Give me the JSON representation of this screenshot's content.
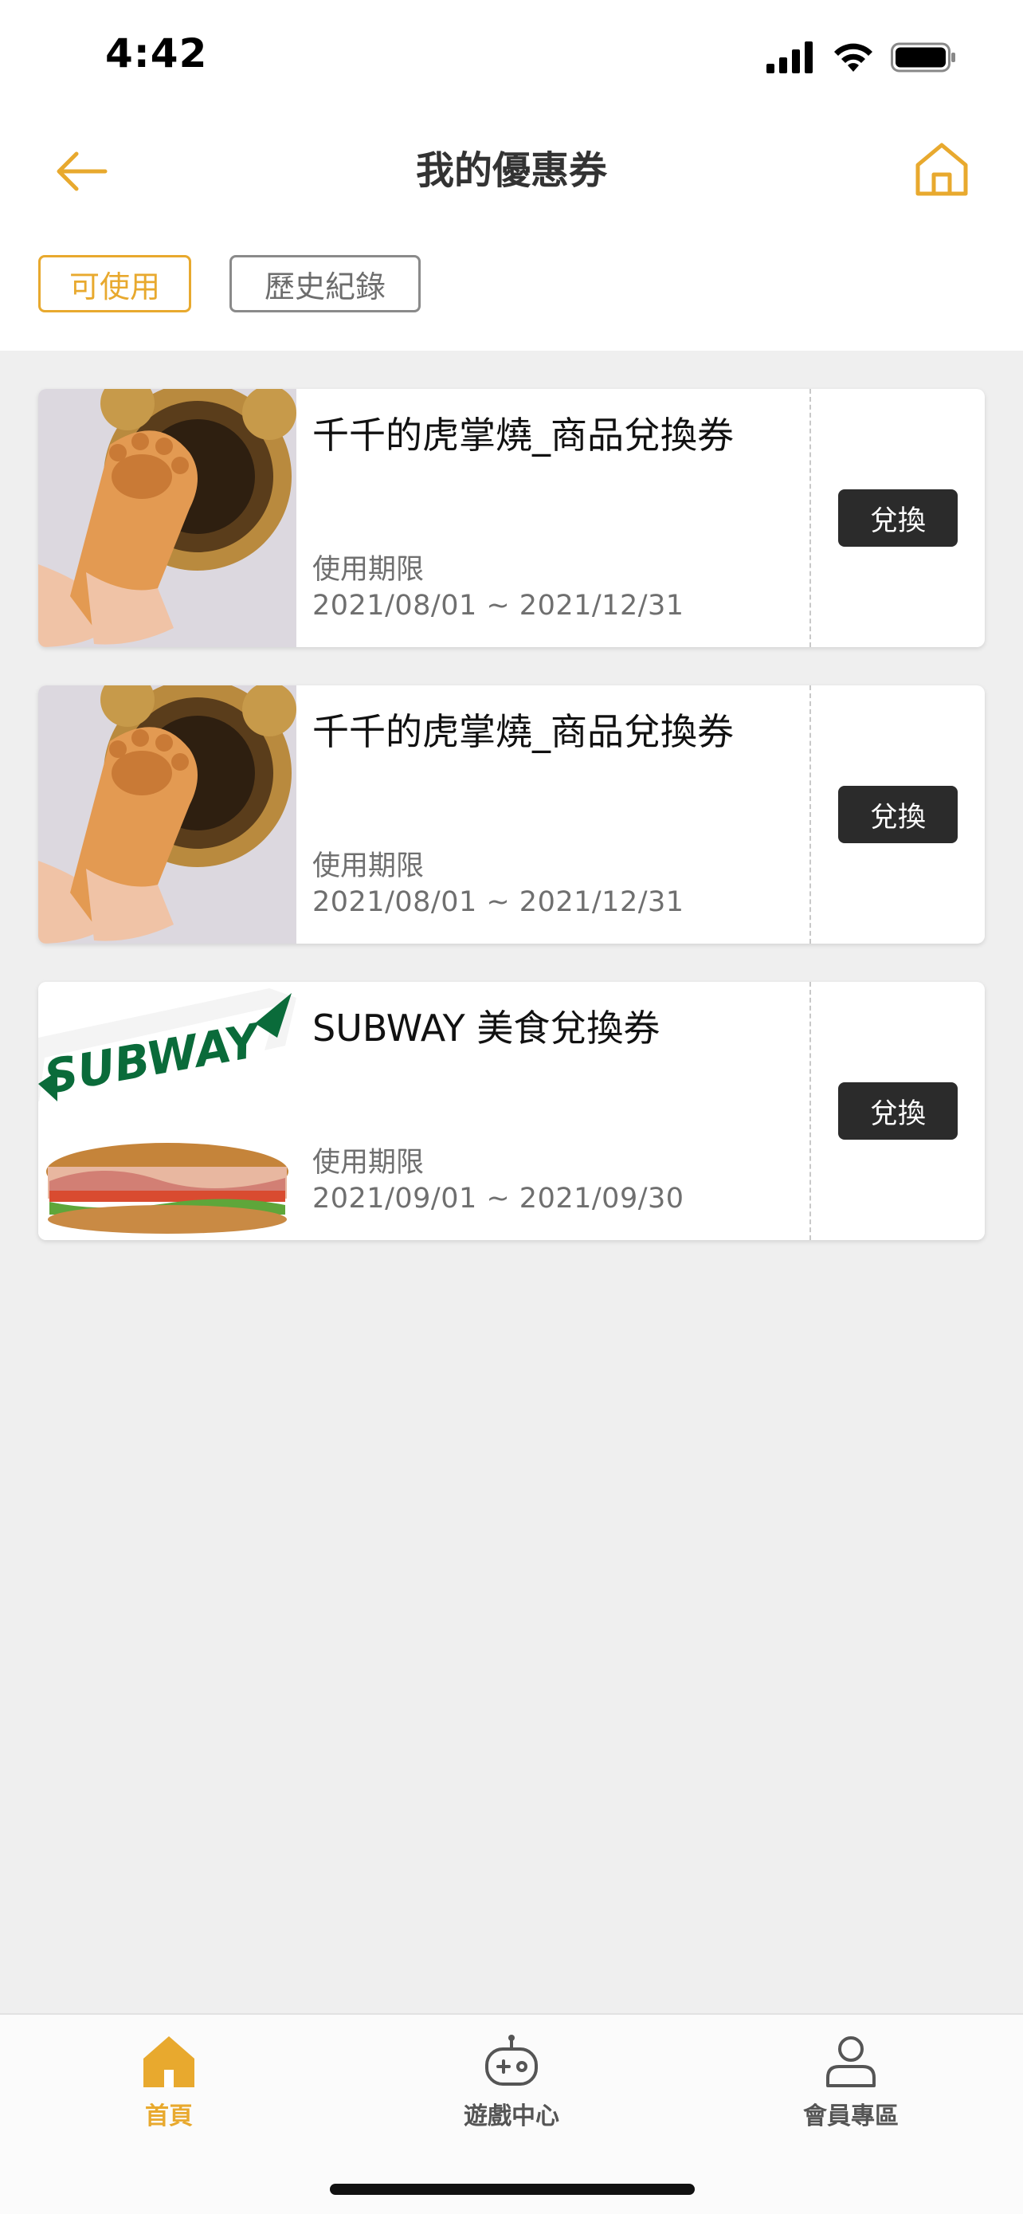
{
  "status_bar": {
    "time": "4:42"
  },
  "header": {
    "title": "我的優惠券"
  },
  "tabs": [
    {
      "label": "可使用",
      "active": true
    },
    {
      "label": "歷史紀錄",
      "active": false
    }
  ],
  "coupons": [
    {
      "title": "千千的虎掌燒_商品兌換券",
      "validity_label": "使用期限",
      "validity_range": "2021/08/01 ~ 2021/12/31",
      "button": "兌換"
    },
    {
      "title": "千千的虎掌燒_商品兌換券",
      "validity_label": "使用期限",
      "validity_range": "2021/08/01 ~ 2021/12/31",
      "button": "兌換"
    },
    {
      "title": "SUBWAY 美食兌換券",
      "validity_label": "使用期限",
      "validity_range": "2021/09/01 ~ 2021/09/30",
      "button": "兌換",
      "logo_text": "SUBWAY"
    }
  ],
  "bottom_nav": [
    {
      "label": "首頁",
      "icon": "home-icon",
      "active": true
    },
    {
      "label": "遊戲中心",
      "icon": "gamepad-icon",
      "active": false
    },
    {
      "label": "會員專區",
      "icon": "user-icon",
      "active": false
    }
  ],
  "colors": {
    "accent": "#e8a92e",
    "button_dark": "#2b2b2b",
    "background": "#efefef"
  }
}
